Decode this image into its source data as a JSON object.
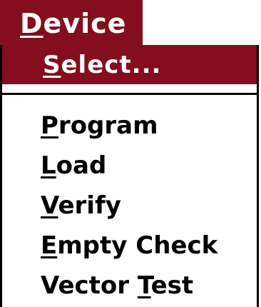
{
  "colors": {
    "highlight": "#840e1d",
    "highlight_text": "#ffffff",
    "menu_background": "#ffffff",
    "menu_text": "#000000"
  },
  "menu": {
    "title": {
      "mnemonic": "D",
      "rest": "evice"
    },
    "items": [
      {
        "mnemonic": "S",
        "rest": "elect...",
        "selected": true
      },
      {
        "mnemonic": "P",
        "rest": "rogram"
      },
      {
        "mnemonic": "L",
        "rest": "oad"
      },
      {
        "mnemonic": "V",
        "rest": "erify"
      },
      {
        "mnemonic": "E",
        "rest": "mpty Check"
      },
      {
        "before": "Vector ",
        "mnemonic": "T",
        "rest": "est"
      }
    ]
  }
}
